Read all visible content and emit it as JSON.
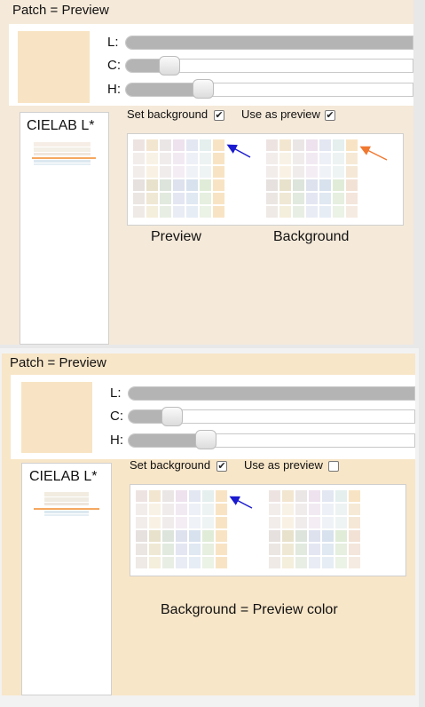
{
  "panel1": {
    "title": "Patch = Preview",
    "slider_labels": [
      "L:",
      "C:",
      "H:"
    ],
    "set_background_label": "Set background",
    "use_as_preview_label": "Use as preview",
    "set_background_checked": true,
    "use_as_preview_checked": true,
    "left_label": "CIELAB L*",
    "caption_preview": "Preview",
    "caption_background": "Background"
  },
  "panel2": {
    "title": "Patch = Preview",
    "slider_labels": [
      "L:",
      "C:",
      "H:"
    ],
    "set_background_label": "Set background",
    "use_as_preview_label": "Use as preview",
    "set_background_checked": true,
    "use_as_preview_checked": false,
    "left_label": "CIELAB L*",
    "caption": "Background = Preview color"
  },
  "check_glyph": "✔",
  "colors": {
    "patch": "#f8e4c4",
    "arrow_blue": "#1a1ad0",
    "arrow_orange": "#f07830"
  }
}
